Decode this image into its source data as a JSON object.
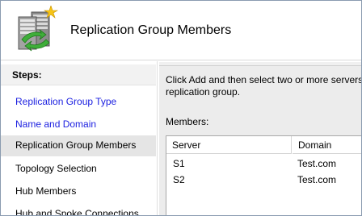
{
  "header": {
    "title": "Replication Group Members"
  },
  "steps": {
    "heading": "Steps:",
    "items": [
      {
        "label": "Replication Group Type"
      },
      {
        "label": "Name and Domain"
      },
      {
        "label": "Replication Group Members"
      },
      {
        "label": "Topology Selection"
      },
      {
        "label": "Hub Members"
      },
      {
        "label": "Hub and Spoke Connections"
      }
    ]
  },
  "content": {
    "instructions_line1": "Click Add and then select two or more servers",
    "instructions_line2": "replication group.",
    "members_label": "Members:",
    "table": {
      "columns": [
        "Server",
        "Domain"
      ],
      "rows": [
        {
          "server": "S1",
          "domain": "Test.com"
        },
        {
          "server": "S2",
          "domain": "Test.com"
        }
      ]
    }
  },
  "colors": {
    "link": "#1a1ee0",
    "current_step_bg": "#e5e5e5",
    "panel_bg": "#ececec"
  },
  "icons": {
    "wizard": "replication-server-icon"
  }
}
